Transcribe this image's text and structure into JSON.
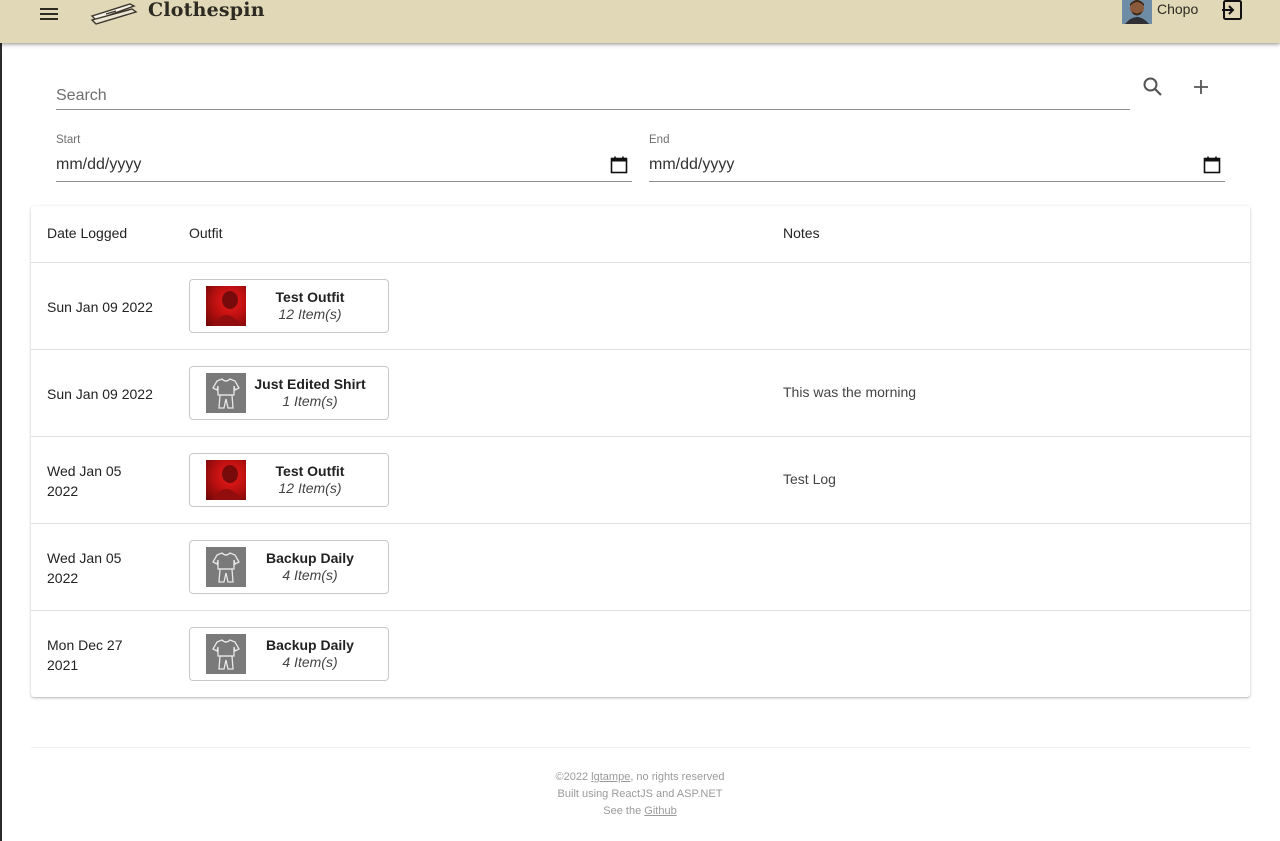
{
  "appbar": {
    "title": "Clothespin",
    "username": "Chopo",
    "menu_icon": "menu-icon",
    "logo_icon": "clothespin-logo",
    "logout_icon": "logout-icon",
    "color": "#e0d8b7"
  },
  "search": {
    "placeholder": "Search",
    "value": "",
    "search_icon": "search-icon",
    "add_icon": "plus-icon"
  },
  "filters": {
    "start_label": "Start",
    "start_value": "mm/dd/yyyy",
    "end_label": "End",
    "end_value": "mm/dd/yyyy",
    "calendar_icon": "calendar-icon"
  },
  "table": {
    "headers": {
      "date": "Date Logged",
      "outfit": "Outfit",
      "notes": "Notes"
    },
    "rows": [
      {
        "date_line1": "Sun Jan 09 2022",
        "date_line2": "",
        "outfit_name": "Test Outfit",
        "outfit_count": "12 Item(s)",
        "thumb": "photo",
        "notes": ""
      },
      {
        "date_line1": "Sun Jan 09 2022",
        "date_line2": "",
        "outfit_name": "Just Edited Shirt",
        "outfit_count": "1 Item(s)",
        "thumb": "clothing-icon",
        "notes": "This was the morning"
      },
      {
        "date_line1": "Wed Jan 05",
        "date_line2": "2022",
        "outfit_name": "Test Outfit",
        "outfit_count": "12 Item(s)",
        "thumb": "photo",
        "notes": "Test Log"
      },
      {
        "date_line1": "Wed Jan 05",
        "date_line2": "2022",
        "outfit_name": "Backup Daily",
        "outfit_count": "4 Item(s)",
        "thumb": "clothing-icon",
        "notes": ""
      },
      {
        "date_line1": "Mon Dec 27",
        "date_line2": "2021",
        "outfit_name": "Backup Daily",
        "outfit_count": "4 Item(s)",
        "thumb": "clothing-icon",
        "notes": ""
      }
    ]
  },
  "footer": {
    "copyright_prefix": "©2022 ",
    "author_link": "lgtampe",
    "copyright_suffix": ", no rights reserved",
    "built_using": "Built using ReactJS and ASP.NET",
    "see_the": "See the ",
    "github_link": "Github"
  }
}
